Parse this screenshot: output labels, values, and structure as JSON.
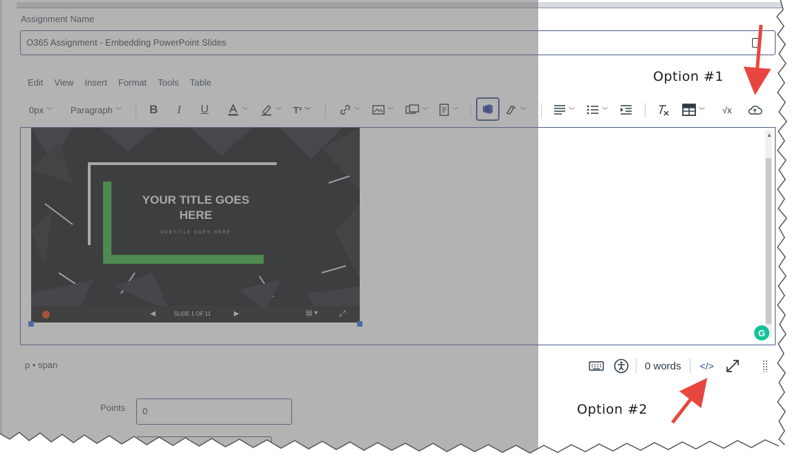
{
  "form": {
    "assignment_name_label": "Assignment Name",
    "assignment_name_value": "O365 Assignment - Embedding PowerPoint Slides",
    "points_label": "Points",
    "points_value": "0"
  },
  "menubar": [
    "Edit",
    "View",
    "Insert",
    "Format",
    "Tools",
    "Table"
  ],
  "toolbar": {
    "font_size": "0px",
    "block_format": "Paragraph",
    "bold": "B",
    "italic": "I",
    "underline": "U",
    "superscript": "T²",
    "math": "√x",
    "icons": [
      "bold-icon",
      "italic-icon",
      "underline-icon",
      "text-color-icon",
      "highlight-icon",
      "superscript-icon",
      "link-icon",
      "image-icon",
      "media-icon",
      "document-icon",
      "office365-icon",
      "apps-icon",
      "align-icon",
      "list-icon",
      "indent-icon",
      "clear-format-icon",
      "table-icon",
      "equation-icon",
      "upload-cloud-icon"
    ]
  },
  "slide": {
    "title": "YOUR TITLE GOES HERE",
    "subtitle": "SUBTITLE GOES HERE",
    "counter": "SLIDE 1 OF 11"
  },
  "statusbar": {
    "path": "p • span",
    "word_count": "0 words",
    "html_editor_label": "</>"
  },
  "annotations": {
    "option1": "Option #1",
    "option2": "Option #2",
    "arrow_color": "#e8473f"
  },
  "colors": {
    "accent_border": "#4a5a88",
    "grammarly": "#15c39a",
    "slide_green": "#2ea82e"
  }
}
